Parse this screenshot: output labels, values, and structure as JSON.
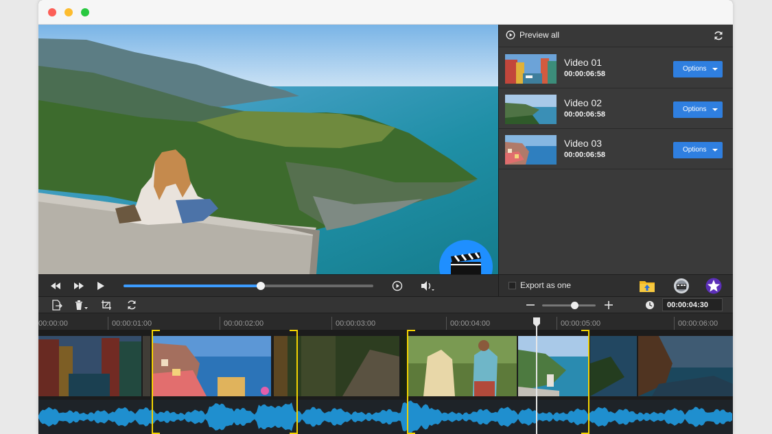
{
  "window": {
    "controls": [
      "close",
      "minimize",
      "maximize"
    ]
  },
  "player": {
    "controls": [
      "rewind-icon",
      "fast-forward-icon",
      "play-icon",
      "play-circle-icon",
      "volume-icon"
    ],
    "progress": 0.55
  },
  "sidebar": {
    "preview_all_label": "Preview all",
    "videos": [
      {
        "title": "Video 01",
        "duration": "00:00:06:58",
        "options_label": "Options"
      },
      {
        "title": "Video 02",
        "duration": "00:00:06:58",
        "options_label": "Options"
      },
      {
        "title": "Video 03",
        "duration": "00:00:06:58",
        "options_label": "Options"
      }
    ],
    "export_label": "Export as one",
    "footer_icons": [
      "folder-upload-icon",
      "film-reel-icon",
      "imovie-star-icon"
    ]
  },
  "timeline": {
    "toolbar_icons": [
      "export-clip-icon",
      "delete-icon",
      "trim-icon",
      "refresh-icon",
      "zoom-out-icon",
      "zoom-in-icon",
      "clock-icon"
    ],
    "zoom_level": 0.6,
    "current_time": "00:00:04:30",
    "ruler_labels": [
      "00:00:00",
      "00:00:01:00",
      "00:00:02:00",
      "00:00:03:00",
      "00:00:04:00",
      "00:00:05:00",
      "00:00:06:00"
    ]
  },
  "colors": {
    "accent": "#2f7fe0",
    "selection": "#f4d400",
    "waveform": "#1f8fcf"
  }
}
